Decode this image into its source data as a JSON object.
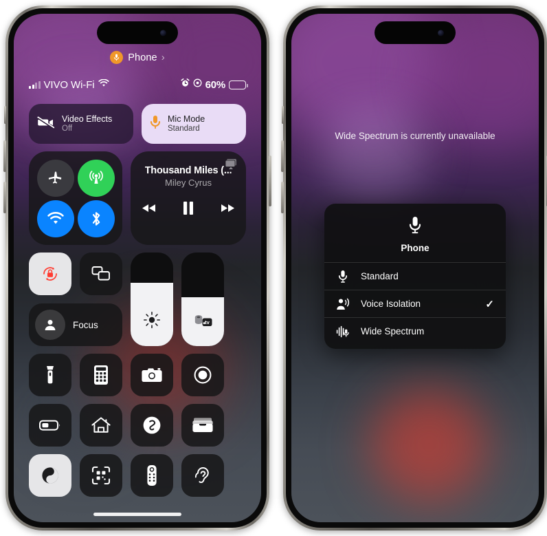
{
  "left_phone": {
    "call_banner": {
      "label": "Phone",
      "icon": "microphone-icon",
      "chevron": "›",
      "dot_color": "#f0982a"
    },
    "status_bar": {
      "carrier": "VIVO Wi-Fi",
      "signal_icon": "cellular-bars-icon",
      "wifi_icon": "wifi-icon",
      "alarm_icon": "alarm-clock-icon",
      "focus_icon": "focus-target-icon",
      "battery_percent": "60%",
      "battery_icon": "battery-icon"
    },
    "effects": [
      {
        "title": "Video Effects",
        "subtitle": "Off",
        "icon": "video-slash-icon",
        "state": "off",
        "style": "dark"
      },
      {
        "title": "Mic Mode",
        "subtitle": "Standard",
        "icon": "microphone-icon",
        "state": "on",
        "style": "light"
      }
    ],
    "connectivity": [
      {
        "name": "airplane-mode",
        "icon": "airplane-icon",
        "color": "#3a3a3f",
        "on": false
      },
      {
        "name": "cellular-data",
        "icon": "cellular-antenna-icon",
        "color": "#30d158",
        "on": true
      },
      {
        "name": "wifi",
        "icon": "wifi-icon",
        "color": "#0a84ff",
        "on": true
      },
      {
        "name": "bluetooth",
        "icon": "bluetooth-icon",
        "color": "#0a84ff",
        "on": true
      }
    ],
    "now_playing": {
      "title": "Thousand Miles (...",
      "artist": "Miley Cyrus",
      "airplay_icon": "airplay-icon",
      "controls": [
        {
          "name": "rewind-button",
          "icon": "rewind-icon"
        },
        {
          "name": "pause-button",
          "icon": "pause-icon"
        },
        {
          "name": "fast-forward-button",
          "icon": "fast-forward-icon"
        }
      ]
    },
    "toggles_small": [
      {
        "name": "rotation-lock",
        "icon": "rotation-lock-icon",
        "on": true
      },
      {
        "name": "screen-mirroring",
        "icon": "screen-mirroring-icon",
        "on": false
      }
    ],
    "focus": {
      "label": "Focus",
      "icon": "person-icon"
    },
    "sliders": [
      {
        "name": "brightness-slider",
        "icon": "sun-icon",
        "level_percent": 68
      },
      {
        "name": "volume-slider",
        "icon": "appletv-speaker-icon",
        "level_percent": 52
      }
    ],
    "grid": [
      {
        "name": "flashlight",
        "icon": "flashlight-icon",
        "on": false
      },
      {
        "name": "calculator",
        "icon": "calculator-icon",
        "on": false
      },
      {
        "name": "camera",
        "icon": "camera-icon",
        "on": false
      },
      {
        "name": "screen-record",
        "icon": "record-icon",
        "on": false
      },
      {
        "name": "low-power-mode",
        "icon": "battery-icon",
        "on": false
      },
      {
        "name": "home",
        "icon": "home-icon",
        "on": false
      },
      {
        "name": "shazam",
        "icon": "shazam-icon",
        "on": false
      },
      {
        "name": "wallet",
        "icon": "wallet-icon",
        "on": false
      },
      {
        "name": "dark-mode",
        "icon": "dark-mode-icon",
        "on": true
      },
      {
        "name": "code-scanner",
        "icon": "qr-scanner-icon",
        "on": false
      },
      {
        "name": "apple-tv-remote",
        "icon": "remote-icon",
        "on": false
      },
      {
        "name": "hearing",
        "icon": "ear-icon",
        "on": false
      }
    ]
  },
  "right_phone": {
    "notice": "Wide Spectrum is currently unavailable",
    "menu": {
      "header_label": "Phone",
      "header_icon": "microphone-icon",
      "options": [
        {
          "label": "Standard",
          "icon": "microphone-icon",
          "selected": false
        },
        {
          "label": "Voice Isolation",
          "icon": "voice-isolation-icon",
          "selected": true,
          "check": "✓"
        },
        {
          "label": "Wide Spectrum",
          "icon": "wide-spectrum-icon",
          "selected": false
        }
      ]
    }
  },
  "colors": {
    "accent_orange": "#f0982a",
    "accent_blue": "#0a84ff",
    "accent_green": "#30d158",
    "accent_red": "#ff453a",
    "wallpaper_purple": "#6c3471",
    "wallpaper_slate": "#4c525a"
  }
}
